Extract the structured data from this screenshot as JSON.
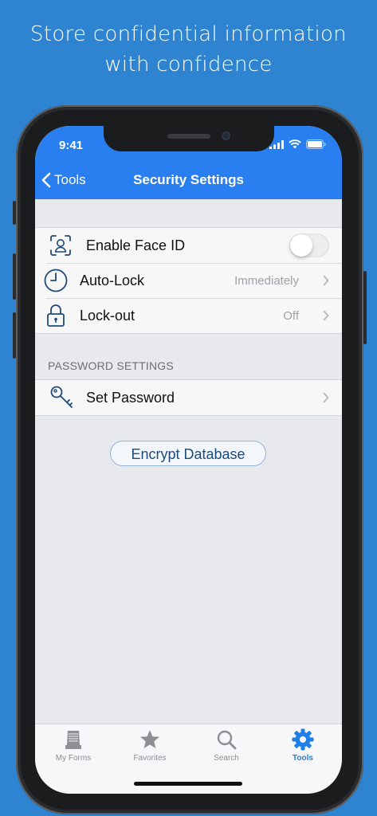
{
  "headline": {
    "line1": "Store confidential information",
    "line2": "with confidence"
  },
  "status_bar": {
    "time": "9:41",
    "icons": [
      "signal-icon",
      "wifi-icon",
      "battery-icon"
    ]
  },
  "nav_bar": {
    "back_label": "Tools",
    "title": "Security Settings"
  },
  "security_group": {
    "rows": [
      {
        "label": "Enable Face ID",
        "icon": "face-id-icon",
        "toggle_on": false
      },
      {
        "label": "Auto-Lock",
        "icon": "clock-icon",
        "value": "Immediately"
      },
      {
        "label": "Lock-out",
        "icon": "lock-icon",
        "value": "Off"
      }
    ]
  },
  "password_section": {
    "header": "PASSWORD SETTINGS",
    "rows": [
      {
        "label": "Set Password",
        "icon": "key-icon"
      }
    ]
  },
  "encrypt_button": "Encrypt Database",
  "tab_bar": {
    "tabs": [
      {
        "label": "My Forms",
        "icon": "forms-stack-icon",
        "active": false
      },
      {
        "label": "Favorites",
        "icon": "star-icon",
        "active": false
      },
      {
        "label": "Search",
        "icon": "search-icon",
        "active": false
      },
      {
        "label": "Tools",
        "icon": "gear-icon",
        "active": true
      }
    ]
  },
  "colors": {
    "background": "#2f84d2",
    "nav_blue": "#2a7ff0",
    "tab_active": "#1e7fe6",
    "tab_inactive": "#8e8e93",
    "icon_blue": "#1f4a7a"
  }
}
